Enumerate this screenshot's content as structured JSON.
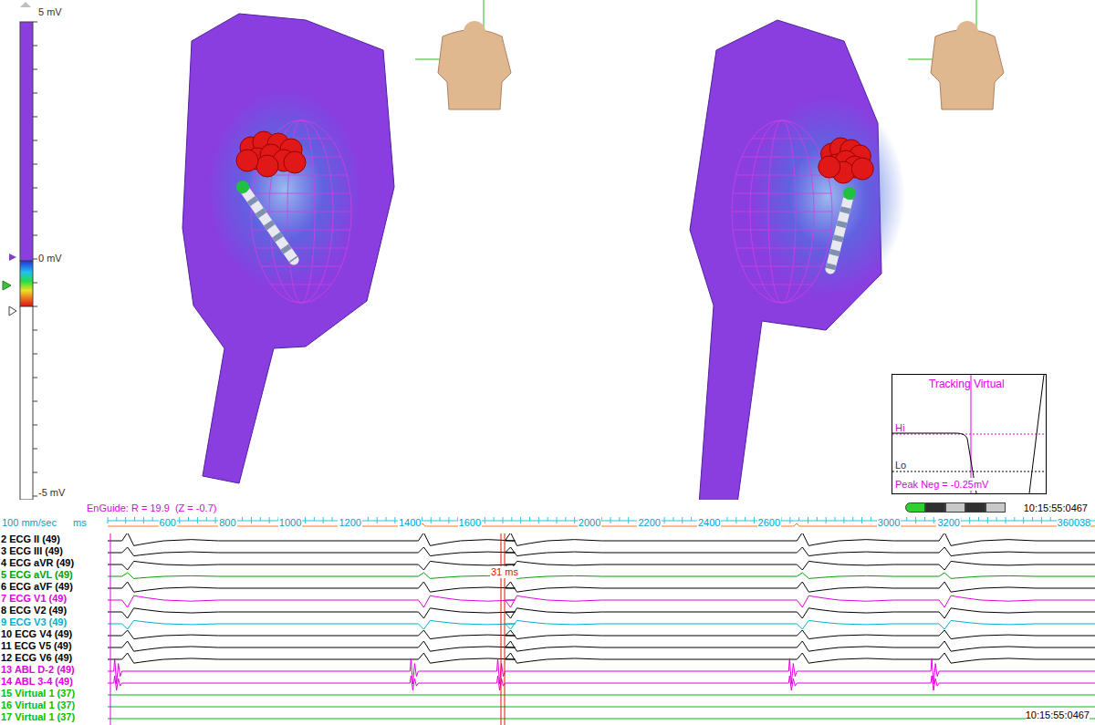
{
  "colorbar": {
    "top_label": "5 mV",
    "mid_label": "0 mV",
    "bottom_label": "-5 mV"
  },
  "inset": {
    "title": "Tracking Virtual",
    "hi": "Hi",
    "lo": "Lo",
    "reading": "Peak Neg = -0.25mV"
  },
  "status": {
    "enguide": "EnGuide: R = 19.9  (Z = -0.7)",
    "progress_level": 0.2,
    "time": "10:15:55:0467"
  },
  "ruler": {
    "speed": "100 mm/sec",
    "unit": "ms",
    "ticks": [
      "600",
      "800",
      "1000",
      "1200",
      "1400",
      "1600",
      "2000",
      "2200",
      "2400",
      "2600",
      "3000",
      "3200",
      "3600"
    ],
    "cut_tick": "38"
  },
  "marker": {
    "label": "31 ms"
  },
  "beat_times_ms": [
    460,
    1450,
    1740,
    2715,
    3190
  ],
  "channels": [
    {
      "label": "2 ECG II (49)",
      "color": "#000000",
      "kind": "ecg",
      "deflection": 9
    },
    {
      "label": "3 ECG III (49)",
      "color": "#000000",
      "kind": "ecg",
      "deflection": 6
    },
    {
      "label": "4 ECG aVR (49)",
      "color": "#000000",
      "kind": "ecg",
      "deflection": -6
    },
    {
      "label": "5 ECG aVL (49)",
      "color": "#00a000",
      "kind": "ecg",
      "deflection": 4
    },
    {
      "label": "6 ECG aVF (49)",
      "color": "#000000",
      "kind": "ecg",
      "deflection": 7
    },
    {
      "label": "7 ECG V1 (49)",
      "color": "#e000e0",
      "kind": "ecg",
      "deflection": -8
    },
    {
      "label": "8 ECG V2 (49)",
      "color": "#000000",
      "kind": "ecg",
      "deflection": -7
    },
    {
      "label": "9 ECG V3 (49)",
      "color": "#00b0d0",
      "kind": "ecg",
      "deflection": -6
    },
    {
      "label": "10 ECG V4 (49)",
      "color": "#000000",
      "kind": "ecg",
      "deflection": 6
    },
    {
      "label": "11 ECG V5 (49)",
      "color": "#000000",
      "kind": "ecg",
      "deflection": 7
    },
    {
      "label": "12 ECG V6 (49)",
      "color": "#000000",
      "kind": "ecg",
      "deflection": 7
    },
    {
      "label": "13 ABL D-2 (49)",
      "color": "#e000e0",
      "kind": "abl",
      "deflection": 14
    },
    {
      "label": "14 ABL 3-4 (49)",
      "color": "#e000e0",
      "kind": "abl",
      "deflection": 8
    },
    {
      "label": "15 Virtual 1 (37)",
      "color": "#00c000",
      "kind": "virtual",
      "deflection": 0
    },
    {
      "label": "16 Virtual 1 (37)",
      "color": "#00c000",
      "kind": "virtual",
      "deflection": 0
    },
    {
      "label": "17 Virtual 1 (37)",
      "color": "#00c000",
      "kind": "virtual",
      "deflection": 0
    }
  ],
  "footer_time": "10:15:55:0467"
}
